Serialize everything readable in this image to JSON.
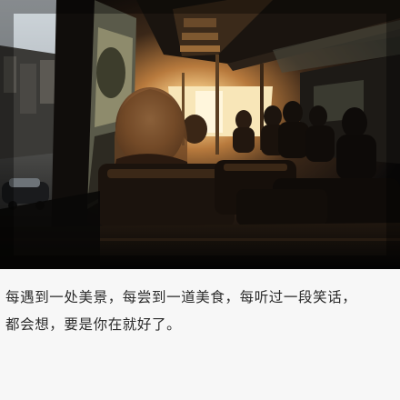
{
  "caption": {
    "line1": "每遇到一处美景，每尝到一道美食，每听过一段笑话，",
    "line2": "都会想，要是你在就好了。"
  },
  "colors": {
    "background": "#f7f7f7",
    "text": "#2b2b2b",
    "light": "#f3c27a",
    "shadow": "#0b0a0a"
  }
}
